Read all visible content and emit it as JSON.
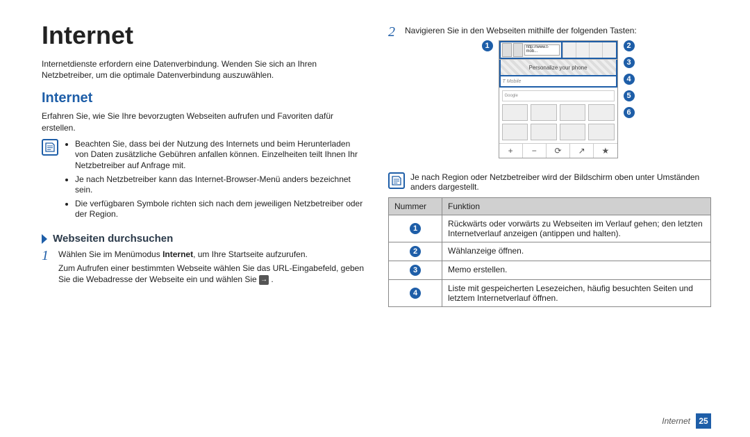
{
  "left": {
    "title": "Internet",
    "intro": "Internetdienste erfordern eine Datenverbindung. Wenden Sie sich an Ihren Netzbetreiber, um die optimale Datenverbindung auszuwählen.",
    "section_heading": "Internet",
    "section_intro": "Erfahren Sie, wie Sie Ihre bevorzugten Webseiten aufrufen und Favoriten dafür erstellen.",
    "note_bullets": [
      "Beachten Sie, dass bei der Nutzung des Internets und beim Herunterladen von Daten zusätzliche Gebühren anfallen können. Einzelheiten teilt Ihnen Ihr Netzbetreiber auf Anfrage mit.",
      "Je nach Netzbetreiber kann das Internet-Browser-Menü anders bezeichnet sein.",
      "Die verfügbaren Symbole richten sich nach dem jeweiligen Netzbetreiber oder der Region."
    ],
    "subsection_heading": "Webseiten durchsuchen",
    "step1_num": "1",
    "step1_a_pre": "Wählen Sie im Menümodus ",
    "step1_a_bold": "Internet",
    "step1_a_post": ", um Ihre Startseite aufzurufen.",
    "step1_b": "Zum Aufrufen einer bestimmten Webseite wählen Sie das URL-Eingabefeld, geben Sie die Webadresse der Webseite ein und wählen Sie ",
    "step1_b_icon_aria": "→"
  },
  "right": {
    "step2_num": "2",
    "step2_text": "Navigieren Sie in den Webseiten mithilfe der folgenden Tasten:",
    "callouts_left": [
      "1"
    ],
    "callouts_right": [
      "2",
      "3",
      "4",
      "5",
      "6"
    ],
    "phone": {
      "addr_placeholder": "http://www.t-mob...",
      "banner_text": "Personalize your phone",
      "sitebar_brand": "T Mobile",
      "search_hint": "Google",
      "bottom_icons": [
        "+",
        "−",
        "⟳",
        "↗",
        "★"
      ]
    },
    "note2": "Je nach Region oder Netzbetreiber wird der Bildschirm oben unter Umständen anders dargestellt.",
    "table_head_num": "Nummer",
    "table_head_func": "Funktion",
    "rows": [
      {
        "n": "1",
        "t": "Rückwärts oder vorwärts zu Webseiten im Verlauf gehen; den letzten Internetverlauf anzeigen (antippen und halten)."
      },
      {
        "n": "2",
        "t": "Wählanzeige öffnen."
      },
      {
        "n": "3",
        "t": "Memo erstellen."
      },
      {
        "n": "4",
        "t": "Liste mit gespeicherten Lesezeichen, häufig besuchten Seiten und letztem Internetverlauf öffnen."
      }
    ]
  },
  "footer": {
    "section": "Internet",
    "page_num": "25"
  }
}
